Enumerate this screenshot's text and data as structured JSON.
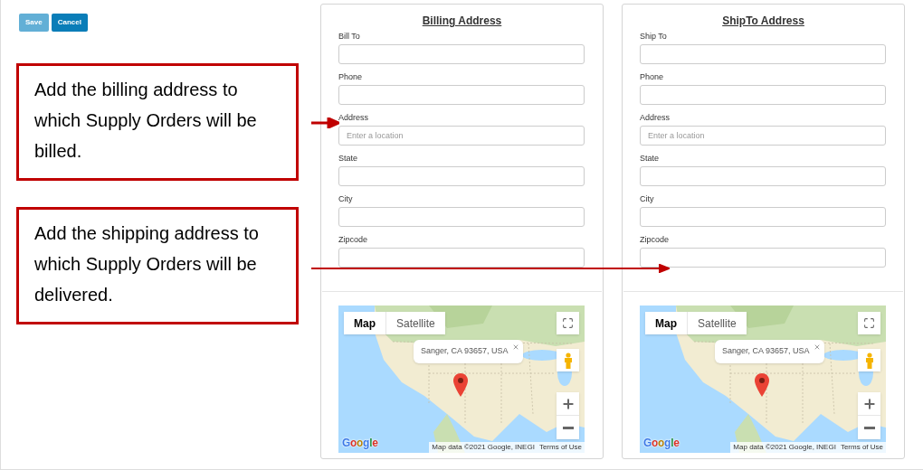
{
  "toolbar": {
    "buttons": [
      {
        "label": "Save",
        "disabled": true
      },
      {
        "label": "Cancel",
        "disabled": false
      }
    ]
  },
  "callouts": [
    {
      "text": "Add the billing address to which Supply Orders will be billed."
    },
    {
      "text": "Add the shipping address to which Supply Orders will be delivered."
    }
  ],
  "panels": [
    {
      "title": "Billing Address",
      "fields": [
        {
          "label": "Bill To"
        },
        {
          "label": "Phone"
        },
        {
          "label": "Address",
          "placeholder": "Enter a location"
        },
        {
          "label": "State"
        },
        {
          "label": "City"
        },
        {
          "label": "Zipcode"
        }
      ],
      "map": {
        "tabs": [
          {
            "label": "Map",
            "selected": true
          },
          {
            "label": "Satellite",
            "selected": false
          }
        ],
        "info": "Sanger, CA 93657, USA",
        "logo": "Google",
        "attribution": "Map data ©2021 Google, INEGI",
        "terms": "Terms of Use"
      }
    },
    {
      "title": "ShipTo Address",
      "fields": [
        {
          "label": "Ship To"
        },
        {
          "label": "Phone"
        },
        {
          "label": "Address",
          "placeholder": "Enter a location"
        },
        {
          "label": "State"
        },
        {
          "label": "City"
        },
        {
          "label": "Zipcode"
        }
      ],
      "map": {
        "tabs": [
          {
            "label": "Map",
            "selected": true
          },
          {
            "label": "Satellite",
            "selected": false
          }
        ],
        "info": "Sanger, CA 93657, USA",
        "logo": "Google",
        "attribution": "Map data ©2021 Google, INEGI",
        "terms": "Terms of Use"
      }
    }
  ]
}
